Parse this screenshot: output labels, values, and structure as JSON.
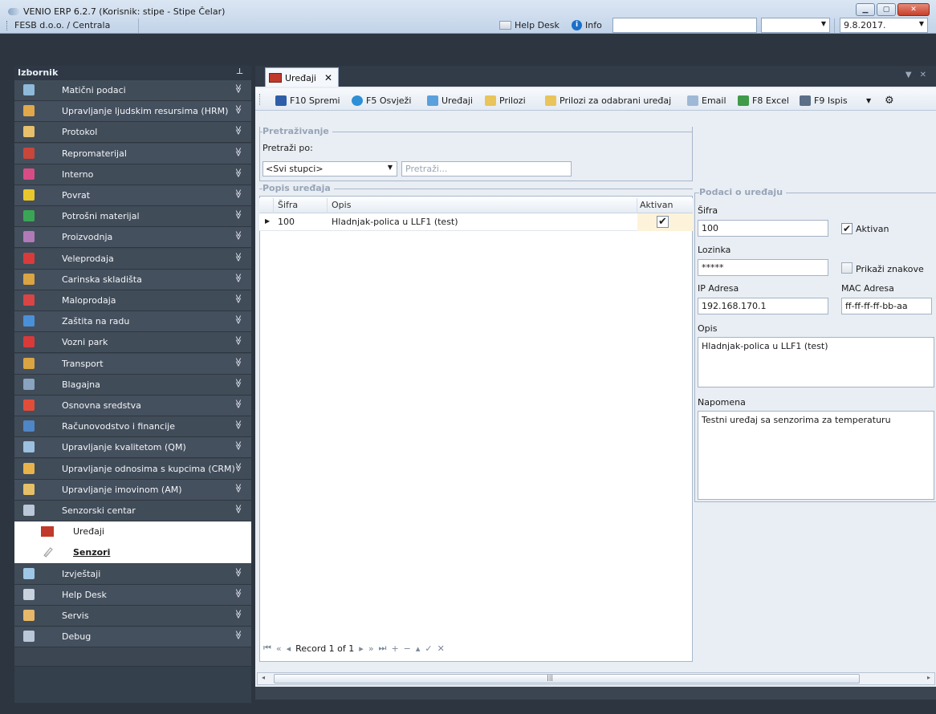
{
  "window": {
    "title": "VENIO ERP 6.2.7 (Korisnik: stipe - Stipe Čelar)",
    "company": "FESB d.o.o. / Centrala",
    "helpdesk_label": "Help Desk",
    "info_label": "Info",
    "date": "9.8.2017.",
    "min": "▁",
    "max": "▢",
    "close": "✕"
  },
  "sidebar": {
    "title": "Izbornik",
    "pin": "⊥",
    "items": [
      {
        "label": "Matični podaci",
        "icon": "documents-icon",
        "color": "#8fb9d9"
      },
      {
        "label": "Upravljanje ljudskim resursima (HRM)",
        "icon": "people-icon",
        "color": "#e0a84a"
      },
      {
        "label": "Protokol",
        "icon": "clipboard-icon",
        "color": "#e7c06c"
      },
      {
        "label": "Repromaterijal",
        "icon": "boxes-icon",
        "color": "#c9463b"
      },
      {
        "label": "Interno",
        "icon": "internal-icon",
        "color": "#d84c86"
      },
      {
        "label": "Povrat",
        "icon": "return-icon",
        "color": "#e8c72c"
      },
      {
        "label": "Potrošni materijal",
        "icon": "share-icon",
        "color": "#3aa655"
      },
      {
        "label": "Proizvodnja",
        "icon": "flask-icon",
        "color": "#b07ab8"
      },
      {
        "label": "Veleprodaja",
        "icon": "wholesale-icon",
        "color": "#d93b3b"
      },
      {
        "label": "Carinska skladišta",
        "icon": "warehouse-icon",
        "color": "#d9a441"
      },
      {
        "label": "Maloprodaja",
        "icon": "retail-icon",
        "color": "#d94444"
      },
      {
        "label": "Zaštita na radu",
        "icon": "safety-icon",
        "color": "#4a90d9"
      },
      {
        "label": "Vozni park",
        "icon": "car-icon",
        "color": "#d83a3a"
      },
      {
        "label": "Transport",
        "icon": "truck-icon",
        "color": "#d9a441"
      },
      {
        "label": "Blagajna",
        "icon": "cashbox-icon",
        "color": "#8aa3bf"
      },
      {
        "label": "Osnovna sredstva",
        "icon": "pie-icon",
        "color": "#e24d3a"
      },
      {
        "label": "Računovodstvo i financije",
        "icon": "calculator-icon",
        "color": "#4f86c6"
      },
      {
        "label": "Upravljanje kvalitetom (QM)",
        "icon": "quality-icon",
        "color": "#9cc0e0"
      },
      {
        "label": "Upravljanje odnosima s kupcima (CRM)",
        "icon": "handshake-icon",
        "color": "#e7b34a"
      },
      {
        "label": "Upravljanje imovinom (AM)",
        "icon": "folder-icon",
        "color": "#e6c068"
      },
      {
        "label": "Senzorski centar",
        "icon": "sensor-icon",
        "color": "#b9c7d8"
      }
    ],
    "expanded_index": 20,
    "subitems": [
      {
        "label": "Uređaji",
        "icon": "device-icon"
      },
      {
        "label": "Senzori",
        "icon": "thermometer-icon"
      }
    ],
    "after_items": [
      {
        "label": "Izvještaji",
        "icon": "report-icon",
        "color": "#9fc7e6"
      },
      {
        "label": "Help Desk",
        "icon": "helpdesk-icon",
        "color": "#c8d2de"
      },
      {
        "label": "Servis",
        "icon": "tools-icon",
        "color": "#e7b86a"
      },
      {
        "label": "Debug",
        "icon": "debug-icon",
        "color": "#b9c7d8"
      }
    ],
    "chevron_down": "≫",
    "chevron_up": "≪"
  },
  "tab": {
    "label": "Uređaji",
    "close": "✕"
  },
  "toolbar": {
    "save": "F10 Spremi",
    "refresh": "F5 Osvježi",
    "devices": "Uređaji",
    "attachments": "Prilozi",
    "attachments_selected": "Prilozi za odabrani uređaj",
    "email": "Email",
    "excel": "F8 Excel",
    "print": "F9 Ispis",
    "print_arrow": "▼",
    "settings": "⚙"
  },
  "search": {
    "group_title": "Pretraživanje",
    "by_label": "Pretraži po:",
    "column_value": "<Svi stupci>",
    "placeholder": "Pretraži..."
  },
  "list": {
    "group_title": "Popis uređaja",
    "columns": [
      "Šifra",
      "Opis",
      "Aktivan"
    ],
    "rows": [
      {
        "sifra": "100",
        "opis": "Hladnjak-polica u LLF1 (test)",
        "aktivan": "✔"
      }
    ],
    "navigator": {
      "record": "Record 1 of 1"
    }
  },
  "details": {
    "group_title": "Podaci o uređaju",
    "sifra_label": "Šifra",
    "sifra_value": "100",
    "aktivan_label": "Aktivan",
    "lozinka_label": "Lozinka",
    "lozinka_value": "*****",
    "prikazi_label": "Prikaži znakove",
    "ip_label": "IP Adresa",
    "ip_value": "192.168.170.1",
    "mac_label": "MAC Adresa",
    "mac_value": "ff-ff-ff-ff-bb-aa",
    "opis_label": "Opis",
    "opis_value": "Hladnjak-polica u LLF1 (test)",
    "napomena_label": "Napomena",
    "napomena_value": "Testni uređaj sa senzorima za temperaturu"
  }
}
